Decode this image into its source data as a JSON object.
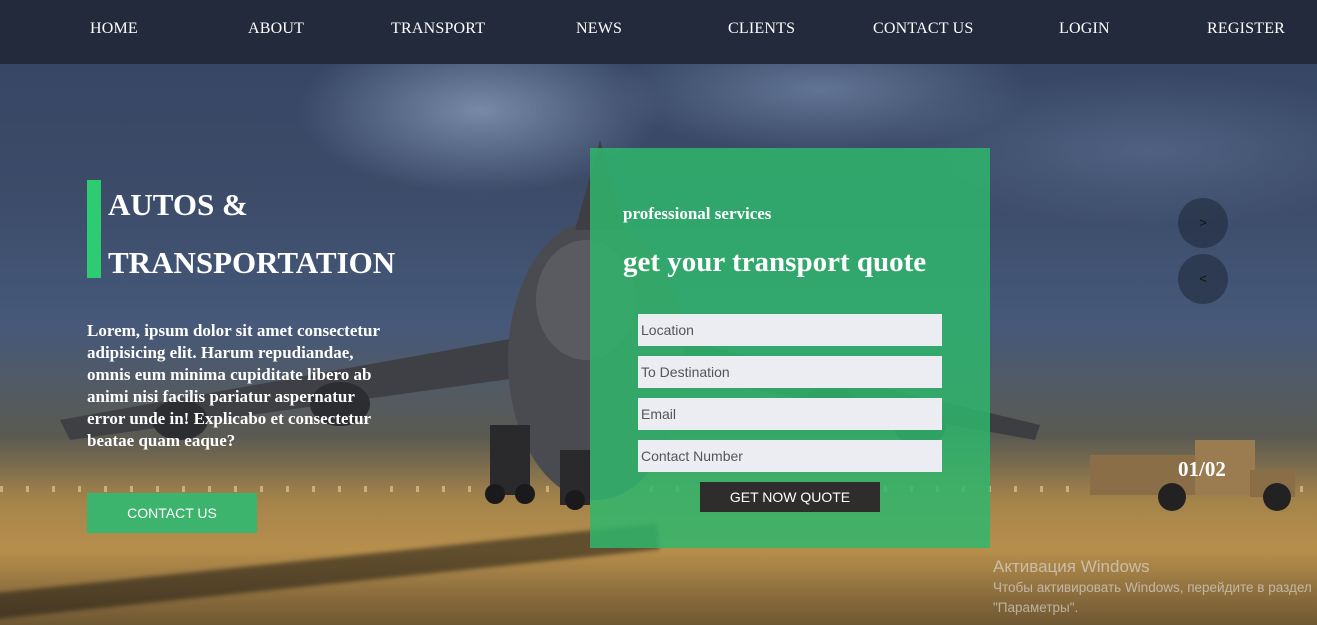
{
  "nav": {
    "items": [
      {
        "label": "HOME"
      },
      {
        "label": "ABOUT"
      },
      {
        "label": "TRANSPORT"
      },
      {
        "label": "NEWS"
      },
      {
        "label": "CLIENTS"
      },
      {
        "label": "CONTACT US"
      },
      {
        "label": "LOGIN"
      },
      {
        "label": "REGISTER"
      }
    ]
  },
  "hero": {
    "title_line1": "AUTOS &",
    "title_line2": "TRANSPORTATION",
    "description": "Lorem, ipsum dolor sit amet consectetur adipisicing elit. Harum repudiandae, omnis eum minima cupiditate libero ab animi nisi facilis pariatur aspernatur error unde in! Explicabo et consectetur beatae quam eaque?",
    "cta_label": "CONTACT US"
  },
  "quote": {
    "eyebrow": "professional services",
    "title": "get your transport quote",
    "fields": {
      "location": {
        "placeholder": "Location",
        "value": ""
      },
      "destination": {
        "placeholder": "To Destination",
        "value": ""
      },
      "email": {
        "placeholder": "Email",
        "value": ""
      },
      "contact": {
        "placeholder": "Contact Number",
        "value": ""
      }
    },
    "submit_label": "GET NOW QUOTE"
  },
  "slider": {
    "next_label": ">",
    "prev_label": "<",
    "counter": "01/02"
  },
  "watermark": {
    "title": "Активация Windows",
    "subtitle": "Чтобы активировать Windows, перейдите в раздел \"Параметры\"."
  },
  "colors": {
    "nav_bg": "#222a3b",
    "accent_green": "#2ecc71",
    "panel_green": "#2eb86c",
    "button_dark": "#2f2d2c"
  }
}
